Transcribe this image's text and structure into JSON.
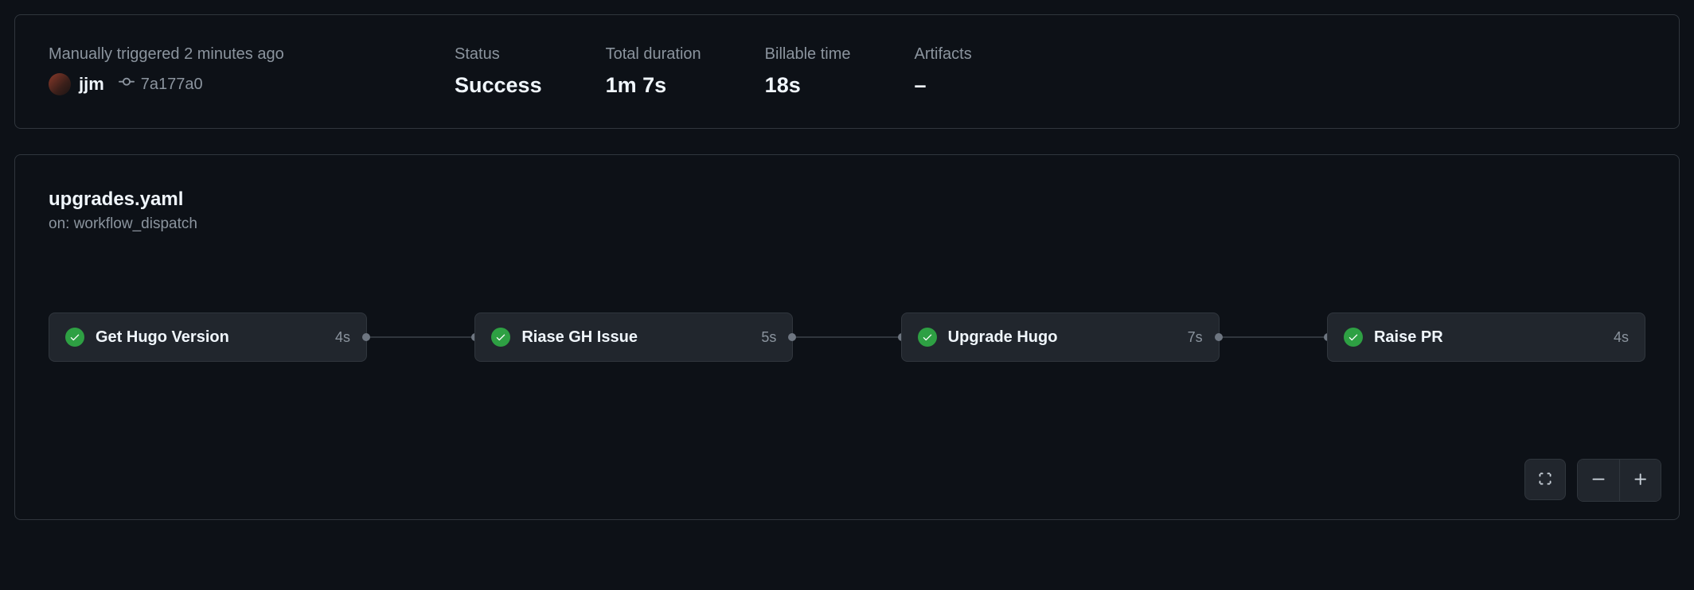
{
  "summary": {
    "trigger_text": "Manually triggered 2 minutes ago",
    "user": "jjm",
    "commit_sha": "7a177a0",
    "status_label": "Status",
    "status_value": "Success",
    "duration_label": "Total duration",
    "duration_value": "1m 7s",
    "billable_label": "Billable time",
    "billable_value": "18s",
    "artifacts_label": "Artifacts",
    "artifacts_value": "–"
  },
  "workflow": {
    "name": "upgrades.yaml",
    "trigger": "on: workflow_dispatch",
    "jobs": [
      {
        "name": "Get Hugo Version",
        "duration": "4s",
        "status": "success"
      },
      {
        "name": "Riase GH Issue",
        "duration": "5s",
        "status": "success"
      },
      {
        "name": "Upgrade Hugo",
        "duration": "7s",
        "status": "success"
      },
      {
        "name": "Raise PR",
        "duration": "4s",
        "status": "success"
      }
    ]
  }
}
